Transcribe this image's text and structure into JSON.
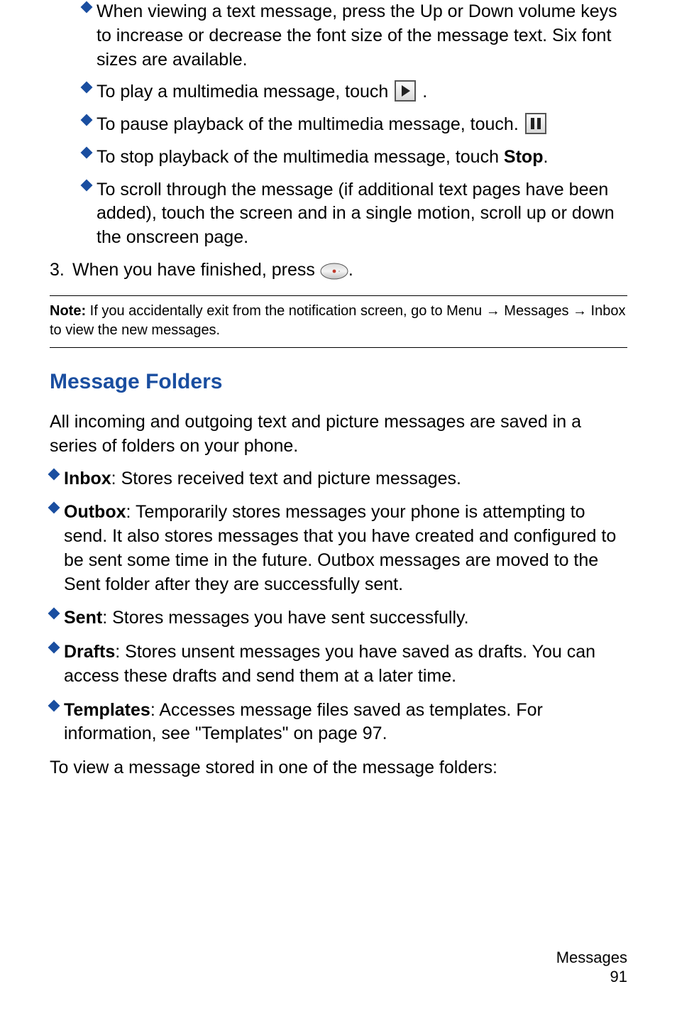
{
  "sub_bullets": [
    {
      "text": "When viewing a text message, press the Up or Down volume keys to increase or decrease the font size of the message text. Six font sizes are available.",
      "icon": null
    },
    {
      "prefix": "To play a multimedia message, touch ",
      "suffix": ".",
      "icon": "play"
    },
    {
      "prefix": "To pause playback of the multimedia message, touch.",
      "suffix": "",
      "icon": "pause"
    },
    {
      "prefix": "To stop playback of the multimedia message, touch ",
      "strong": "Stop",
      "suffix": "."
    },
    {
      "text": "To scroll through the message (if additional text pages have been added), touch the screen and in a single motion, scroll up or down the onscreen page."
    }
  ],
  "step3": {
    "num": "3.",
    "prefix": "When you have finished, press ",
    "suffix": "."
  },
  "note": {
    "label": "Note:",
    "p1": " If you accidentally exit from the notification screen, go to Menu ",
    "arrow": "→",
    "p2": " Messages ",
    "p3": " Inbox to view the new messages."
  },
  "section_title": "Message Folders",
  "intro": "All incoming and outgoing text and picture messages are saved in a series of folders on your phone.",
  "folders": [
    {
      "name": "Inbox",
      "desc": ": Stores received text and picture messages."
    },
    {
      "name": "Outbox",
      "desc": ": Temporarily stores messages your phone is attempting to send. It also stores messages that you have created and configured to be sent some time in the future. Outbox messages are moved to the Sent folder after they are successfully sent."
    },
    {
      "name": "Sent",
      "desc": ": Stores messages you have sent successfully."
    },
    {
      "name": "Drafts",
      "desc": ": Stores unsent messages you have saved as drafts. You can access these drafts and send them at a later time."
    },
    {
      "name": "Templates",
      "desc": ": Accesses message files saved as templates. For information, see \"Templates\" on page 97."
    }
  ],
  "closing": "To view a message stored in one of the message folders:",
  "footer": {
    "section": "Messages",
    "page": "91"
  }
}
